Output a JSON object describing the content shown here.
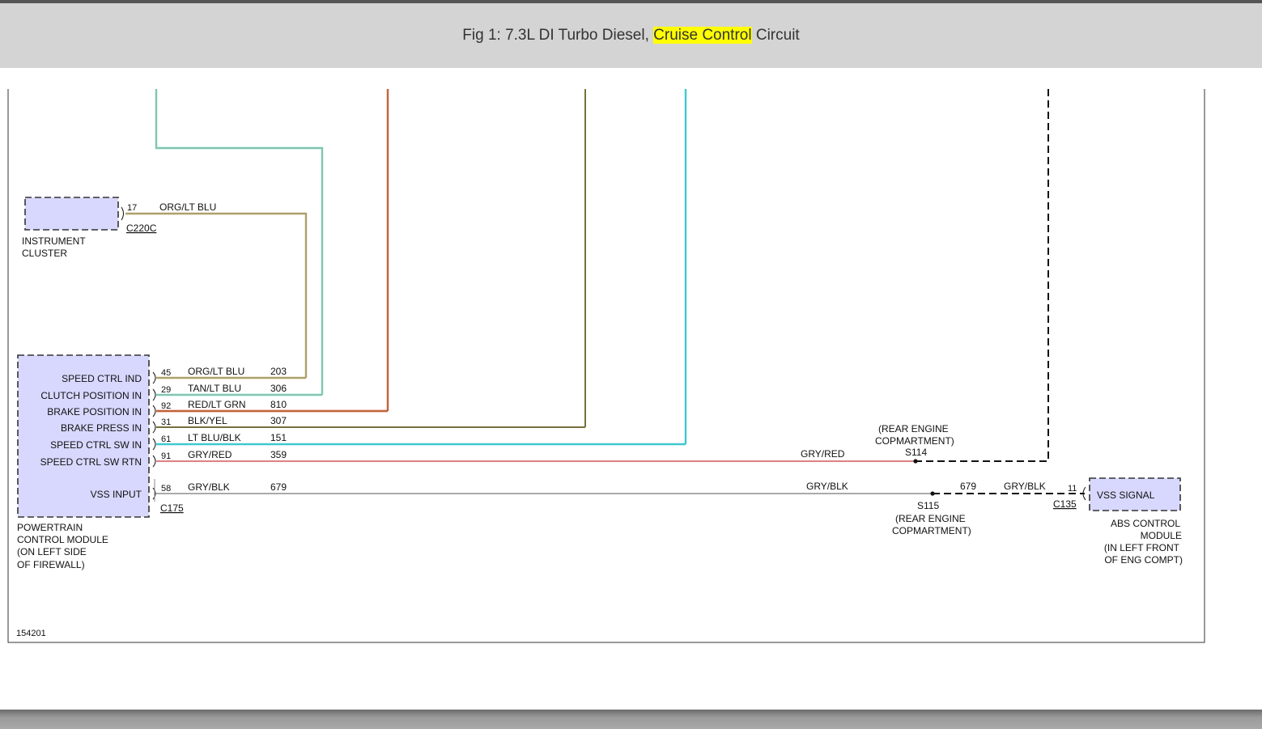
{
  "header": {
    "title_prefix": "Fig 1: 7.3L DI Turbo Diesel, ",
    "title_highlight": "Cruise Control",
    "title_suffix": " Circuit",
    "highlight_color": "#ffff00"
  },
  "diagram": {
    "figure_id": "154201",
    "instrument_cluster": {
      "label_line1": "INSTRUMENT",
      "label_line2": "CLUSTER",
      "pin": "17",
      "wire": "ORG/LT BLU",
      "connector": "C220C"
    },
    "pcm": {
      "label_lines": [
        "POWERTRAIN",
        "CONTROL MODULE",
        "(ON LEFT SIDE",
        "OF FIREWALL)"
      ],
      "connector": "C175",
      "circuits": [
        {
          "name": "SPEED CTRL IND",
          "pin": "45",
          "wire": "ORG/LT BLU",
          "circuit": "203",
          "color": "#d49a3a",
          "color2": "#5ab0d0"
        },
        {
          "name": "CLUTCH POSITION IN",
          "pin": "29",
          "wire": "TAN/LT BLU",
          "circuit": "306",
          "color": "#c8b070",
          "color2": "#5ad0d0"
        },
        {
          "name": "BRAKE POSITION IN",
          "pin": "92",
          "wire": "RED/LT GRN",
          "circuit": "810",
          "color": "#d03020",
          "color2": "#a0c060"
        },
        {
          "name": "BRAKE PRESS IN",
          "pin": "31",
          "wire": "BLK/YEL",
          "circuit": "307",
          "color": "#444444",
          "color2": "#c8b830"
        },
        {
          "name": "SPEED CTRL SW IN",
          "pin": "61",
          "wire": "LT BLU/BLK",
          "circuit": "151",
          "color": "#40c8d0",
          "color2": "#40c8d0"
        },
        {
          "name": "SPEED CTRL SW RTN",
          "pin": "91",
          "wire": "GRY/RED",
          "circuit": "359",
          "color": "#e08080",
          "color2": "#aaaaaa"
        },
        {
          "name": "VSS INPUT",
          "pin": "58",
          "wire": "GRY/BLK",
          "circuit": "679",
          "color": "#aaaaaa",
          "color2": "#888888"
        }
      ]
    },
    "splice_s114": {
      "id": "S114",
      "location_line1": "(REAR ENGINE",
      "location_line2": "COPMARTMENT)",
      "wire_label": "GRY/RED"
    },
    "splice_s115": {
      "id": "S115",
      "location_line1": "(REAR ENGINE",
      "location_line2": "COPMARTMENT)",
      "wire_label": "GRY/BLK",
      "circuit": "679",
      "wire_label_right": "GRY/BLK"
    },
    "abs": {
      "box_label": "VSS SIGNAL",
      "pin": "11",
      "connector": "C135",
      "label_lines": [
        "ABS CONTROL",
        "MODULE",
        "(IN LEFT FRONT",
        "OF ENG COMPT)"
      ]
    }
  }
}
